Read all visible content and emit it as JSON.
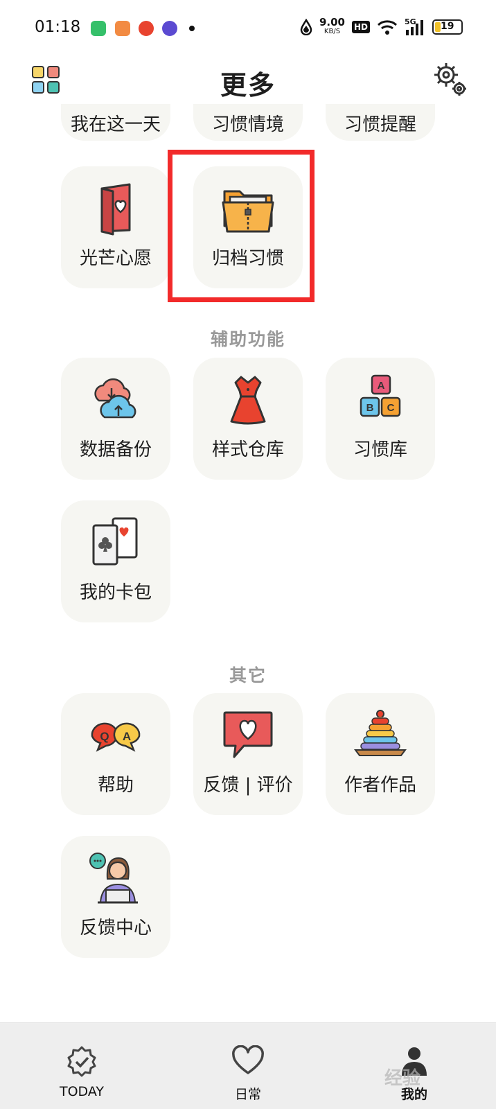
{
  "status_bar": {
    "time": "01:18",
    "net_speed_value": "9.00",
    "net_speed_unit": "KB/S",
    "hd_label": "HD",
    "signal_label": "5G",
    "battery_level": "19"
  },
  "header": {
    "title": "更多",
    "left_icon": "grid-icon",
    "right_icon": "gear-icon"
  },
  "top_row": [
    {
      "label": "我在这一天"
    },
    {
      "label": "习惯情境"
    },
    {
      "label": "习惯提醒"
    }
  ],
  "more_items": [
    {
      "label": "光芒心愿",
      "icon": "wish-card-icon"
    },
    {
      "label": "归档习惯",
      "icon": "archive-folder-icon"
    }
  ],
  "sections": {
    "aux_title": "辅助功能",
    "other_title": "其它"
  },
  "aux_items": [
    {
      "label": "数据备份",
      "icon": "cloud-backup-icon"
    },
    {
      "label": "样式仓库",
      "icon": "dress-icon"
    },
    {
      "label": "习惯库",
      "icon": "abc-blocks-icon"
    },
    {
      "label": "我的卡包",
      "icon": "cards-icon"
    }
  ],
  "other_items": [
    {
      "label": "帮助",
      "icon": "qa-bubbles-icon"
    },
    {
      "label": "反馈 | 评价",
      "icon": "heart-chat-icon"
    },
    {
      "label": "作者作品",
      "icon": "ring-stack-icon"
    },
    {
      "label": "反馈中心",
      "icon": "support-agent-icon"
    }
  ],
  "bottom_nav": [
    {
      "label": "TODAY",
      "icon": "badge-check-icon"
    },
    {
      "label": "日常",
      "icon": "heart-outline-icon"
    },
    {
      "label": "我的",
      "icon": "person-icon"
    }
  ],
  "watermark": "经验",
  "colors": {
    "tile_bg": "#f6f6f2",
    "highlight": "#f22a2a",
    "section_title": "#999999",
    "bottom_bar": "#eeeeee"
  }
}
